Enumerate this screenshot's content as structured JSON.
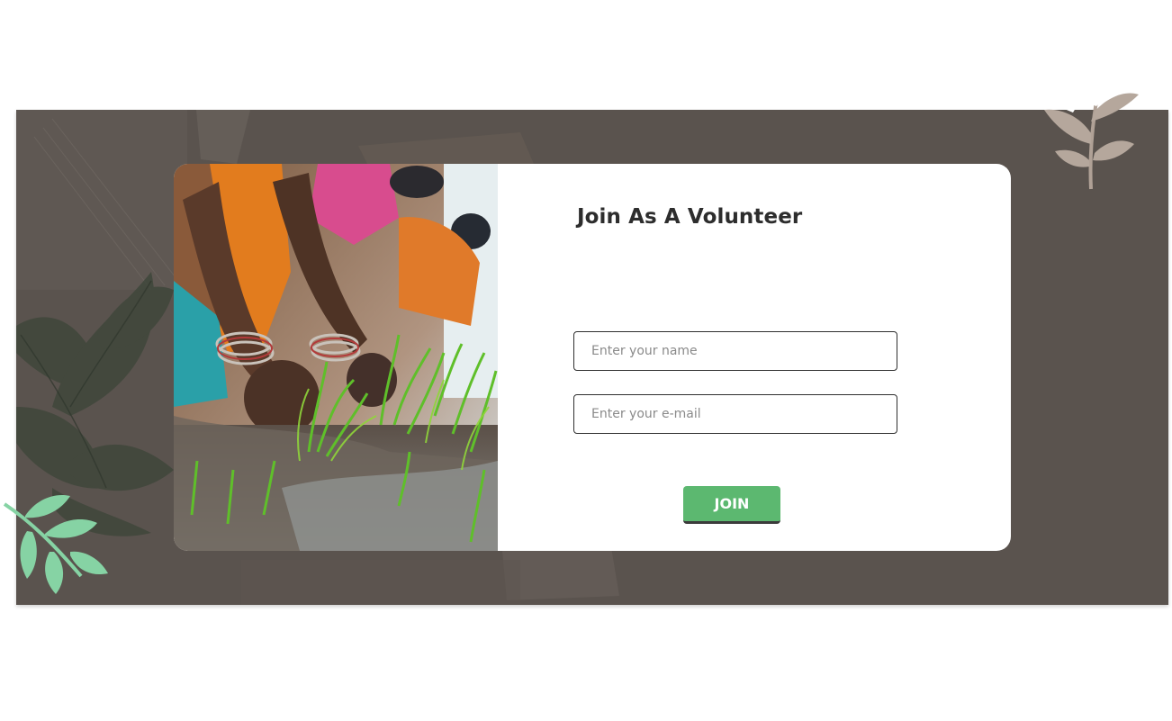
{
  "form": {
    "title": "Join As A Volunteer",
    "name_placeholder": "Enter your name",
    "email_placeholder": "Enter your e-mail",
    "submit_label": "JOIN"
  },
  "colors": {
    "banner_bg": "#5a534e",
    "card_bg": "#ffffff",
    "button_green": "#5cb870",
    "title_text": "#2d2d2d",
    "leaf_dark": "#3d4a3a",
    "leaf_light_green": "#86d3a4",
    "sprig_beige": "#b5a79c"
  },
  "image": {
    "subject": "women planting rice seedlings in a flooded paddy field"
  },
  "decorations": {
    "top_right": "leaf-sprig-icon",
    "bottom_left": "green-leaf-sprig-icon",
    "left_background": "dark-leaves-icon"
  }
}
